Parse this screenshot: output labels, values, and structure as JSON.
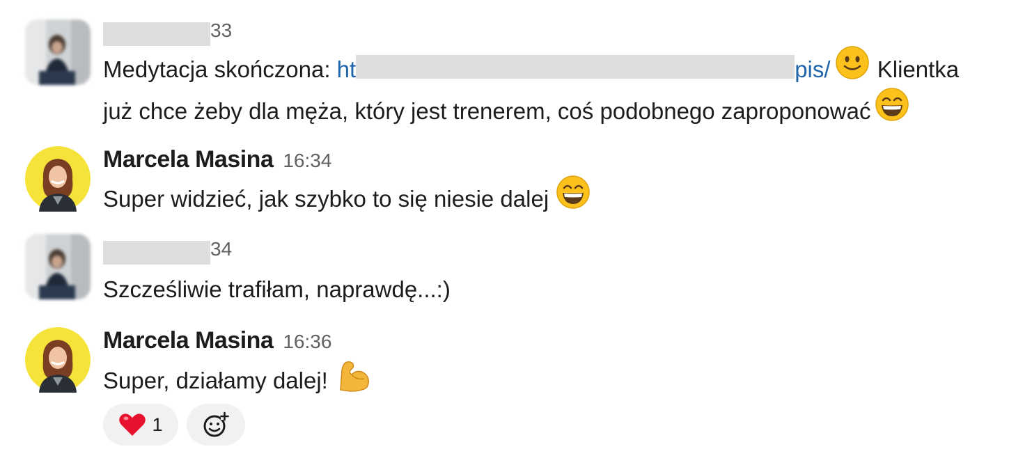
{
  "messages": [
    {
      "author": "",
      "time_suffix": "33",
      "text_prefix": "Medytacja skończona: ",
      "link_start": "ht",
      "link_end": "pis/",
      "emoji_1": "slightly-smiling-face",
      "text_after_link": " Klientka",
      "text_line2": "już chce żeby dla męża, który jest trenerem, coś podobnego zaproponować",
      "emoji_2": "grinning-face-with-smiling-eyes"
    },
    {
      "author": "Marcela Masina",
      "time": "16:34",
      "text": "Super widzieć, jak szybko to się niesie dalej",
      "emoji": "grinning-face-with-smiling-eyes"
    },
    {
      "author": "",
      "time_suffix": "34",
      "text": "Szcześliwie trafiłam, naprawdę...:)"
    },
    {
      "author": "Marcela Masina",
      "time": "16:36",
      "text": "Super, działamy dalej!",
      "emoji": "flexed-biceps"
    }
  ],
  "reactions": [
    {
      "emoji": "red-heart",
      "count": "1"
    },
    {
      "emoji": "add-reaction-icon",
      "count": ""
    }
  ],
  "colors": {
    "link": "#1f64a8",
    "timestamp": "#616061",
    "reaction_bg": "#f1f1f1",
    "redaction": "#dedede",
    "avatar_yellow": "#f6e33a"
  }
}
